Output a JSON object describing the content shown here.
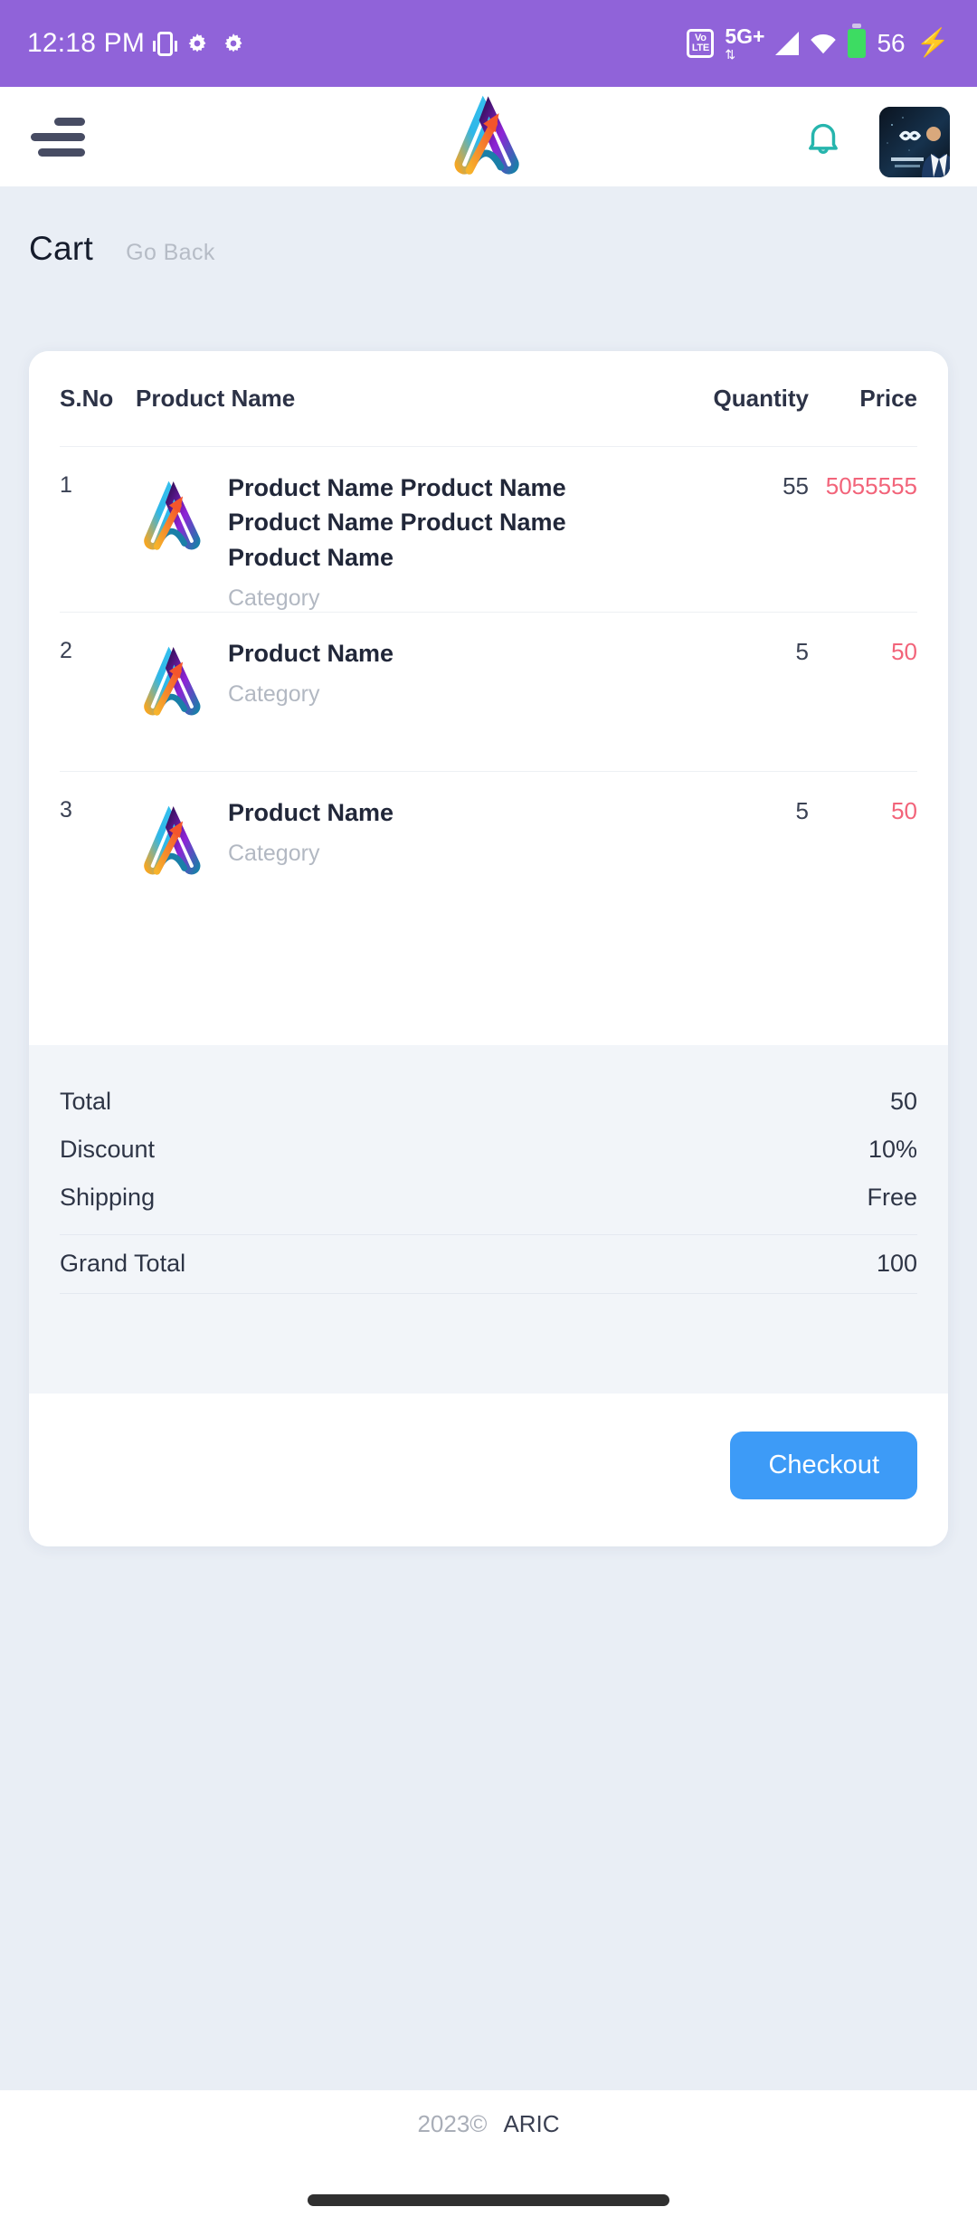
{
  "status_bar": {
    "time": "12:18 PM",
    "vibrate_icon": "vibrate-icon",
    "gear_icons": [
      "gear-icon",
      "gear-icon"
    ],
    "volte_top": "Vo",
    "volte_bottom": "LTE",
    "network_label": "5G+",
    "network_arrows": "⇅",
    "battery_percent": "56",
    "charging_icon": "charging-bolt-icon",
    "wifi_icon": "wifi-icon",
    "signal_icon": "signal-bars-icon"
  },
  "header": {
    "menu_icon": "hamburger-menu-icon",
    "logo_icon": "aric-logo-icon",
    "notification_icon": "bell-icon",
    "avatar_label": "user-avatar"
  },
  "page": {
    "title": "Cart",
    "go_back": "Go Back"
  },
  "table": {
    "columns": {
      "sno": "S.No",
      "product_name": "Product Name",
      "quantity": "Quantity",
      "price": "Price"
    },
    "rows": [
      {
        "sno": "1",
        "name": "Product Name Product Name Product Name Product Name Product Name",
        "category": "Category",
        "quantity": "55",
        "price": "5055555"
      },
      {
        "sno": "2",
        "name": "Product Name",
        "category": "Category",
        "quantity": "5",
        "price": "50"
      },
      {
        "sno": "3",
        "name": "Product Name",
        "category": "Category",
        "quantity": "5",
        "price": "50"
      }
    ]
  },
  "summary": {
    "total_label": "Total",
    "total_value": "50",
    "discount_label": "Discount",
    "discount_value": "10%",
    "shipping_label": "Shipping",
    "shipping_value": "Free",
    "grand_total_label": "Grand Total",
    "grand_total_value": "100"
  },
  "actions": {
    "checkout_label": "Checkout"
  },
  "footer": {
    "year": "2023©",
    "brand": "ARIC"
  },
  "colors": {
    "status_bar": "#9063d9",
    "page_background": "#e9eef5",
    "card_background": "#ffffff",
    "summary_background": "#f2f5f9",
    "price_accent": "#f2647a",
    "checkout_accent": "#3d9bf7",
    "bell_accent": "#26b5ad",
    "battery": "#3ddc62"
  }
}
